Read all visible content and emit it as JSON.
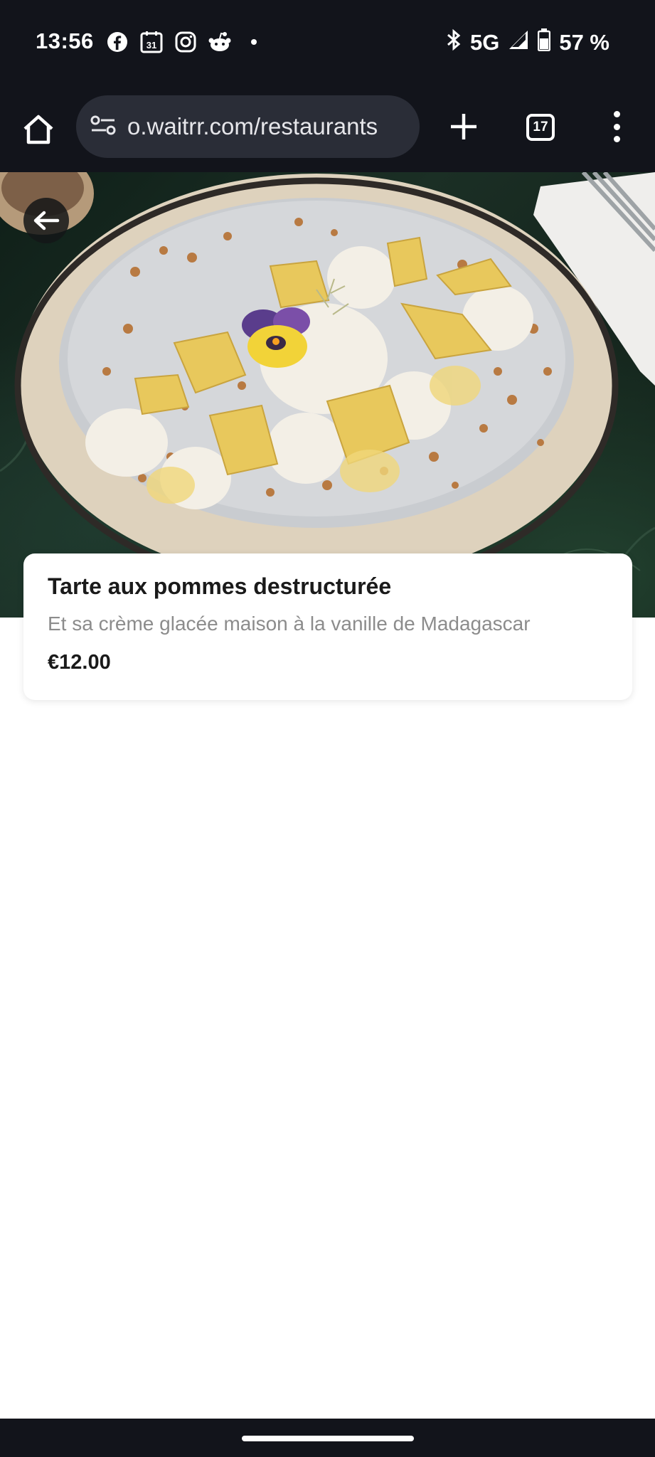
{
  "status_bar": {
    "time": "13:56",
    "notification_icons": [
      "facebook-icon",
      "calendar-icon",
      "instagram-icon",
      "reddit-icon",
      "dot-icon"
    ],
    "calendar_day": "31",
    "network": "5G",
    "battery": "57 %"
  },
  "browser": {
    "url": "o.waitrr.com/restaurants",
    "tab_count": "17"
  },
  "item": {
    "title": "Tarte aux pommes destructurée",
    "description": "Et sa crème glacée maison à la vanille de Madagascar",
    "price": "€12.00"
  },
  "colors": {
    "system_bar": "#12141b",
    "url_box": "#2a2d37",
    "card_bg": "#ffffff",
    "desc_text": "#8c8c8c"
  }
}
